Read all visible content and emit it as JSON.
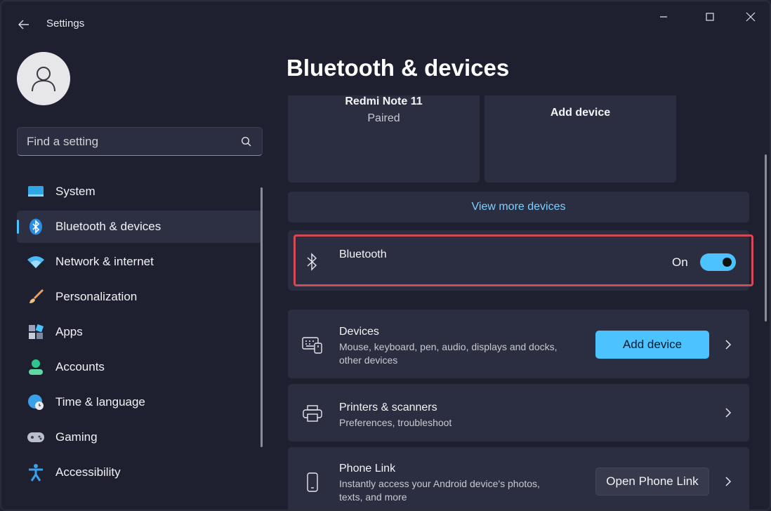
{
  "window": {
    "title": "Settings"
  },
  "search": {
    "placeholder": "Find a setting"
  },
  "sidebar": {
    "items": [
      {
        "label": "System",
        "icon": "monitor-icon"
      },
      {
        "label": "Bluetooth & devices",
        "icon": "bluetooth-icon",
        "active": true
      },
      {
        "label": "Network & internet",
        "icon": "wifi-icon"
      },
      {
        "label": "Personalization",
        "icon": "brush-icon"
      },
      {
        "label": "Apps",
        "icon": "apps-icon"
      },
      {
        "label": "Accounts",
        "icon": "person-icon"
      },
      {
        "label": "Time & language",
        "icon": "globe-clock-icon"
      },
      {
        "label": "Gaming",
        "icon": "gamepad-icon"
      },
      {
        "label": "Accessibility",
        "icon": "accessibility-icon"
      }
    ]
  },
  "main": {
    "title": "Bluetooth & devices",
    "device_cards": [
      {
        "name": "Redmi Note 11",
        "status": "Paired"
      },
      {
        "name": "Add device"
      }
    ],
    "view_more": "View more devices",
    "bluetooth": {
      "label": "Bluetooth",
      "state": "On",
      "enabled": true
    },
    "rows": {
      "devices": {
        "title": "Devices",
        "desc1": "Mouse, keyboard, pen, audio, displays and docks,",
        "desc2": "other devices",
        "button": "Add device"
      },
      "printers": {
        "title": "Printers & scanners",
        "desc": "Preferences, troubleshoot"
      },
      "phone": {
        "title": "Phone Link",
        "desc1": "Instantly access your Android device's photos,",
        "desc2": "texts, and more",
        "button": "Open Phone Link"
      }
    }
  },
  "colors": {
    "accent": "#4cc2ff",
    "highlight": "#d24a55",
    "background": "#1e2030",
    "card": "#2b2e40"
  }
}
